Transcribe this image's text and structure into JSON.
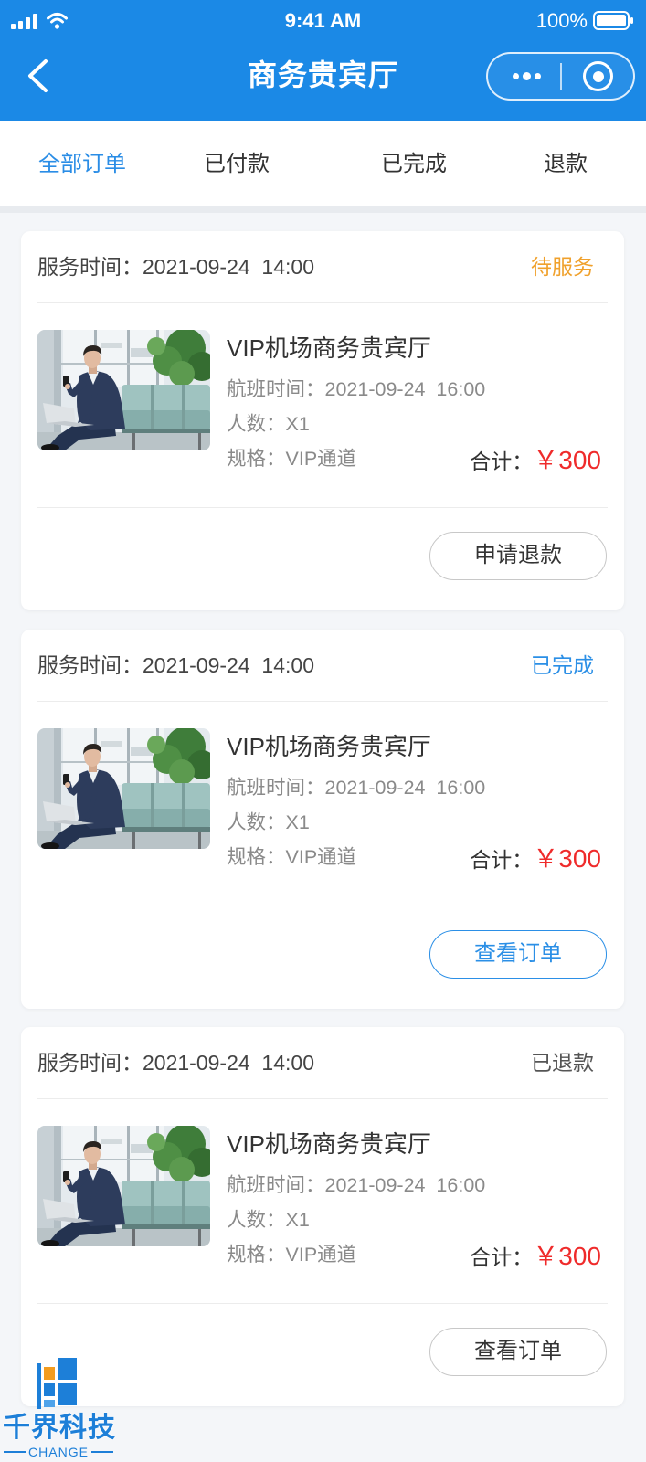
{
  "status_bar": {
    "time": "9:41 AM",
    "battery_text": "100%",
    "signal_icon": "signal-icon",
    "wifi_icon": "wifi-icon",
    "battery_icon": "battery-icon"
  },
  "nav": {
    "title": "商务贵宾厅",
    "back_icon": "chevron-left-icon",
    "more_icon": "more-dots-icon",
    "close_icon": "target-circle-icon"
  },
  "tabs": [
    {
      "label": "全部订单",
      "active": true
    },
    {
      "label": "已付款",
      "active": false
    },
    {
      "label": "已完成",
      "active": false
    },
    {
      "label": "退款",
      "active": false
    }
  ],
  "orders": [
    {
      "service_time": "服务时间：2021-09-24  14:00",
      "status": "待服务",
      "title": "VIP机场商务贵宾厅",
      "flight_time": "航班时间：2021-09-24  16:00",
      "people": "人数：X1",
      "spec": "规格：VIP通道",
      "total_label": "合计：",
      "price": "￥300",
      "action": "申请退款"
    },
    {
      "service_time": "服务时间：2021-09-24  14:00",
      "status": "已完成",
      "title": "VIP机场商务贵宾厅",
      "flight_time": "航班时间：2021-09-24  16:00",
      "people": "人数：X1",
      "spec": "规格：VIP通道",
      "total_label": "合计：",
      "price": "￥300",
      "action": "查看订单"
    },
    {
      "service_time": "服务时间：2021-09-24  14:00",
      "status": "已退款",
      "title": "VIP机场商务贵宾厅",
      "flight_time": "航班时间：2021-09-24  16:00",
      "people": "人数：X1",
      "spec": "规格：VIP通道",
      "total_label": "合计：",
      "price": "￥300",
      "action": "查看订单"
    }
  ],
  "colors": {
    "brand_blue": "#1b89e6",
    "tab_active": "#2a8de6",
    "status_pending": "#f0a12c",
    "status_completed": "#2b8fe6",
    "status_refunded": "#555555",
    "price_red": "#ef2b2b"
  },
  "watermark": {
    "brand": "千界科技",
    "sub": "CHANGE"
  }
}
